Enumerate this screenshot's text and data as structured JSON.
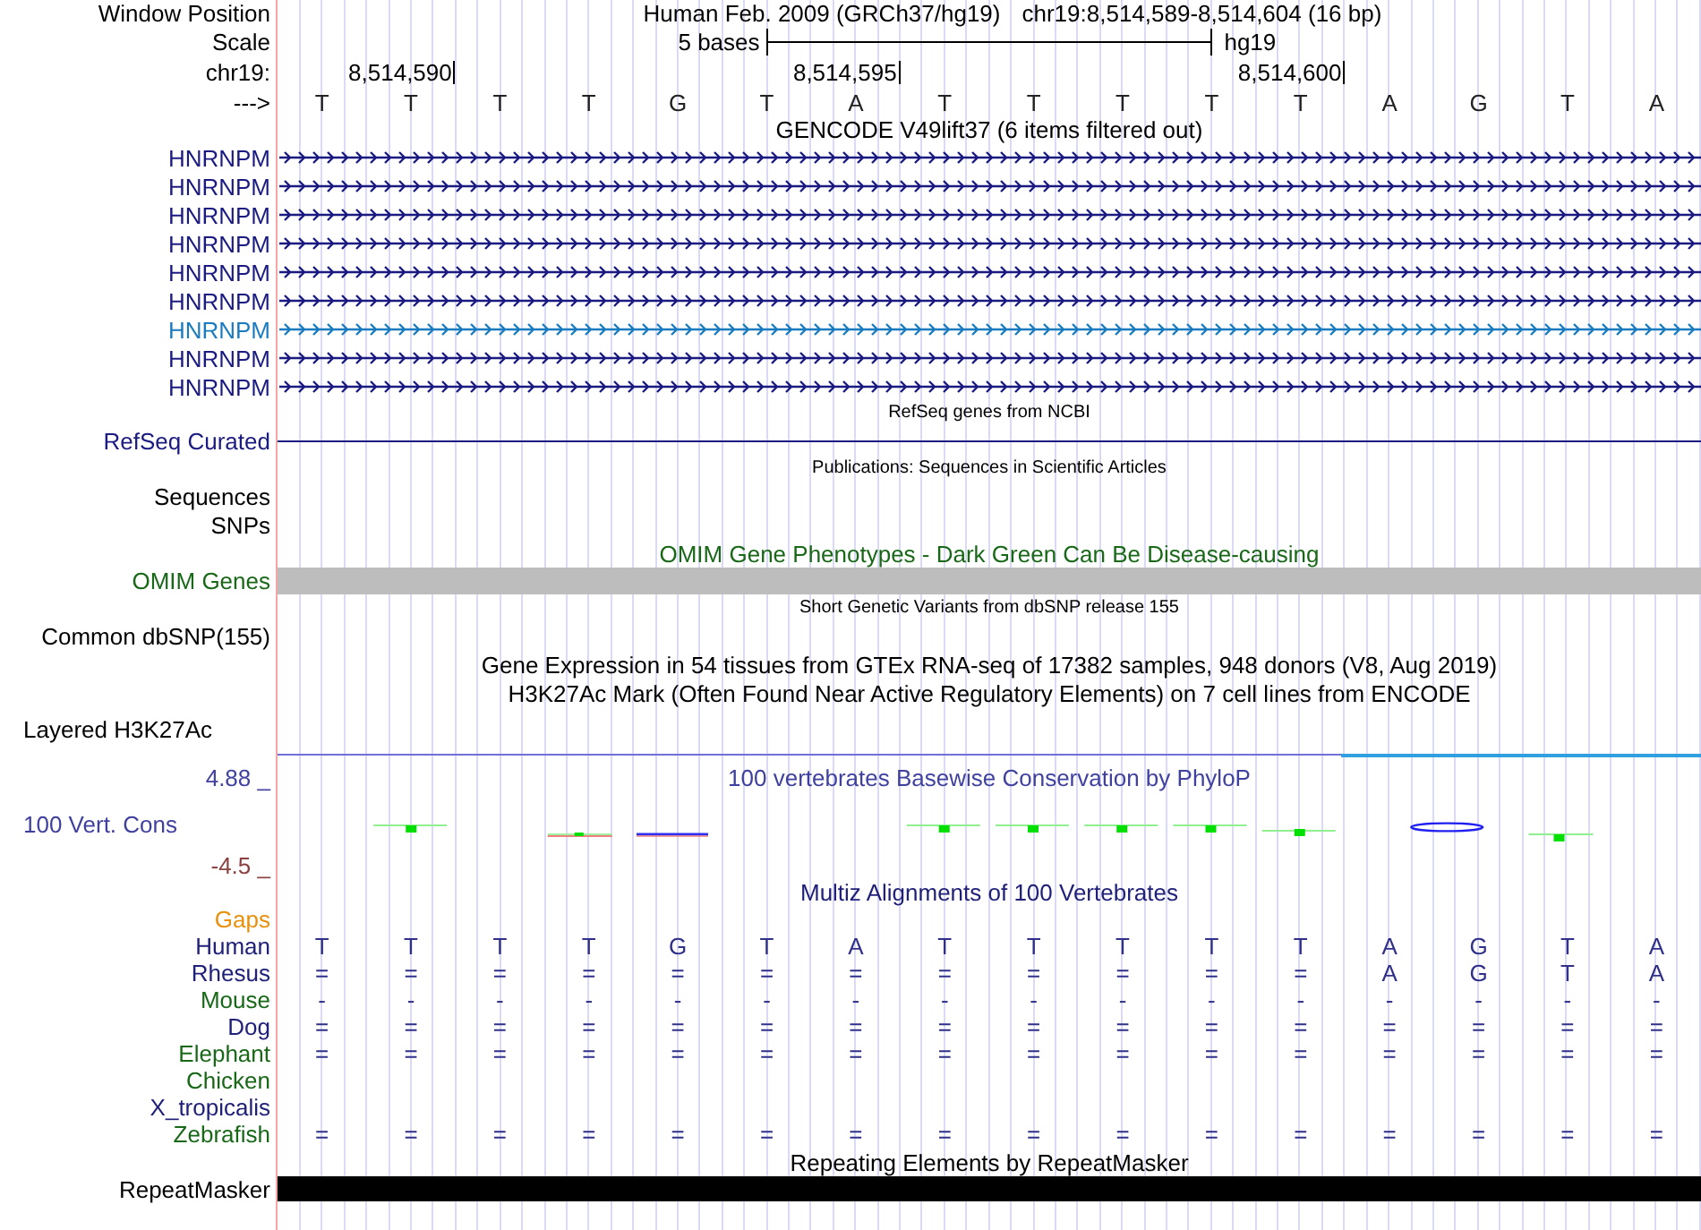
{
  "header": {
    "window_position_label": "Window Position",
    "assembly": "Human Feb. 2009 (GRCh37/hg19)",
    "position": "chr19:8,514,589-8,514,604 (16 bp)",
    "scale_label": "Scale",
    "scale_text": "5 bases",
    "scale_db": "hg19",
    "chrom_label": "chr19:",
    "ticks": [
      "8,514,590",
      "8,514,595",
      "8,514,600"
    ],
    "strand_label": "--->",
    "bases": [
      "T",
      "T",
      "T",
      "T",
      "G",
      "T",
      "A",
      "T",
      "T",
      "T",
      "T",
      "T",
      "A",
      "G",
      "T",
      "A"
    ]
  },
  "gencode": {
    "title": "GENCODE V49lift37 (6 items filtered out)",
    "genes": [
      {
        "name": "HNRNPM",
        "color": "#1a1a80"
      },
      {
        "name": "HNRNPM",
        "color": "#1a1a80"
      },
      {
        "name": "HNRNPM",
        "color": "#1a1a80"
      },
      {
        "name": "HNRNPM",
        "color": "#1a1a80"
      },
      {
        "name": "HNRNPM",
        "color": "#1a1a80"
      },
      {
        "name": "HNRNPM",
        "color": "#1a1a80"
      },
      {
        "name": "HNRNPM",
        "color": "#1a7bbf"
      },
      {
        "name": "HNRNPM",
        "color": "#1a1a80"
      },
      {
        "name": "HNRNPM",
        "color": "#1a1a80"
      }
    ]
  },
  "refseq": {
    "title": "RefSeq genes from NCBI",
    "label": "RefSeq Curated"
  },
  "publications": {
    "title": "Publications: Sequences in Scientific Articles",
    "tracks": [
      "Sequences",
      "SNPs"
    ]
  },
  "omim": {
    "title": "OMIM Gene Phenotypes - Dark Green Can Be Disease-causing",
    "label": "OMIM Genes"
  },
  "dbsnp": {
    "title": "Short Genetic Variants from dbSNP release 155",
    "label": "Common dbSNP(155)"
  },
  "gtex": {
    "title": "Gene Expression in 54 tissues from GTEx RNA-seq of 17382 samples, 948 donors (V8, Aug 2019)"
  },
  "h3k27ac": {
    "title": "H3K27Ac Mark (Often Found Near Active Regulatory Elements) on 7 cell lines from ENCODE",
    "label": "Layered H3K27Ac"
  },
  "phylop": {
    "title": "100 vertebrates Basewise Conservation by PhyloP",
    "label": "100 Vert. Cons",
    "max": "4.88 _",
    "min": "-4.5 _"
  },
  "multiz": {
    "title": "Multiz Alignments of 100 Vertebrates",
    "gaps_label": "Gaps",
    "species": [
      {
        "name": "Human",
        "color": "#20207a",
        "bases": [
          "T",
          "T",
          "T",
          "T",
          "G",
          "T",
          "A",
          "T",
          "T",
          "T",
          "T",
          "T",
          "A",
          "G",
          "T",
          "A"
        ]
      },
      {
        "name": "Rhesus",
        "color": "#20207a",
        "bases": [
          "=",
          "=",
          "=",
          "=",
          "=",
          "=",
          "=",
          "=",
          "=",
          "=",
          "=",
          "=",
          "A",
          "G",
          "T",
          "A"
        ]
      },
      {
        "name": "Mouse",
        "color": "#186818",
        "bases": [
          "-",
          "-",
          "-",
          "-",
          "-",
          "-",
          "-",
          "-",
          "-",
          "-",
          "-",
          "-",
          "-",
          "-",
          "-",
          "-"
        ]
      },
      {
        "name": "Dog",
        "color": "#20207a",
        "bases": [
          "=",
          "=",
          "=",
          "=",
          "=",
          "=",
          "=",
          "=",
          "=",
          "=",
          "=",
          "=",
          "=",
          "=",
          "=",
          "="
        ]
      },
      {
        "name": "Elephant",
        "color": "#186818",
        "bases": [
          "=",
          "=",
          "=",
          "=",
          "=",
          "=",
          "=",
          "=",
          "=",
          "=",
          "=",
          "=",
          "=",
          "=",
          "=",
          "="
        ]
      },
      {
        "name": "Chicken",
        "color": "#186818"
      },
      {
        "name": "X_tropicalis",
        "color": "#20207a"
      },
      {
        "name": "Zebrafish",
        "color": "#186818",
        "bases": [
          "=",
          "=",
          "=",
          "=",
          "=",
          "=",
          "=",
          "=",
          "=",
          "=",
          "=",
          "=",
          "=",
          "=",
          "=",
          "="
        ]
      }
    ]
  },
  "repeatmasker": {
    "title": "Repeating Elements by RepeatMasker",
    "label": "RepeatMasker"
  }
}
